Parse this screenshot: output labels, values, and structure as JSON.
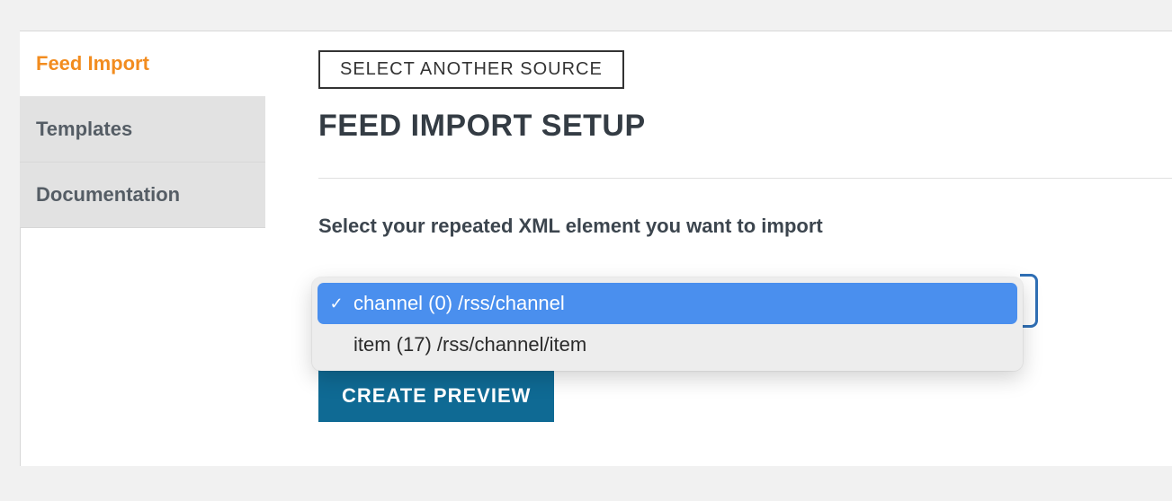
{
  "sidebar": {
    "tabs": [
      {
        "label": "Feed Import",
        "active": true
      },
      {
        "label": "Templates",
        "active": false
      },
      {
        "label": "Documentation",
        "active": false
      }
    ]
  },
  "main": {
    "select_another_label": "SELECT ANOTHER SOURCE",
    "heading": "FEED IMPORT SETUP",
    "instruction": "Select your repeated XML element you want to import",
    "create_button_label": "CREATE PREVIEW"
  },
  "dropdown": {
    "options": [
      {
        "label": "channel (0) /rss/channel",
        "selected": true
      },
      {
        "label": "item (17) /rss/channel/item",
        "selected": false
      }
    ]
  }
}
